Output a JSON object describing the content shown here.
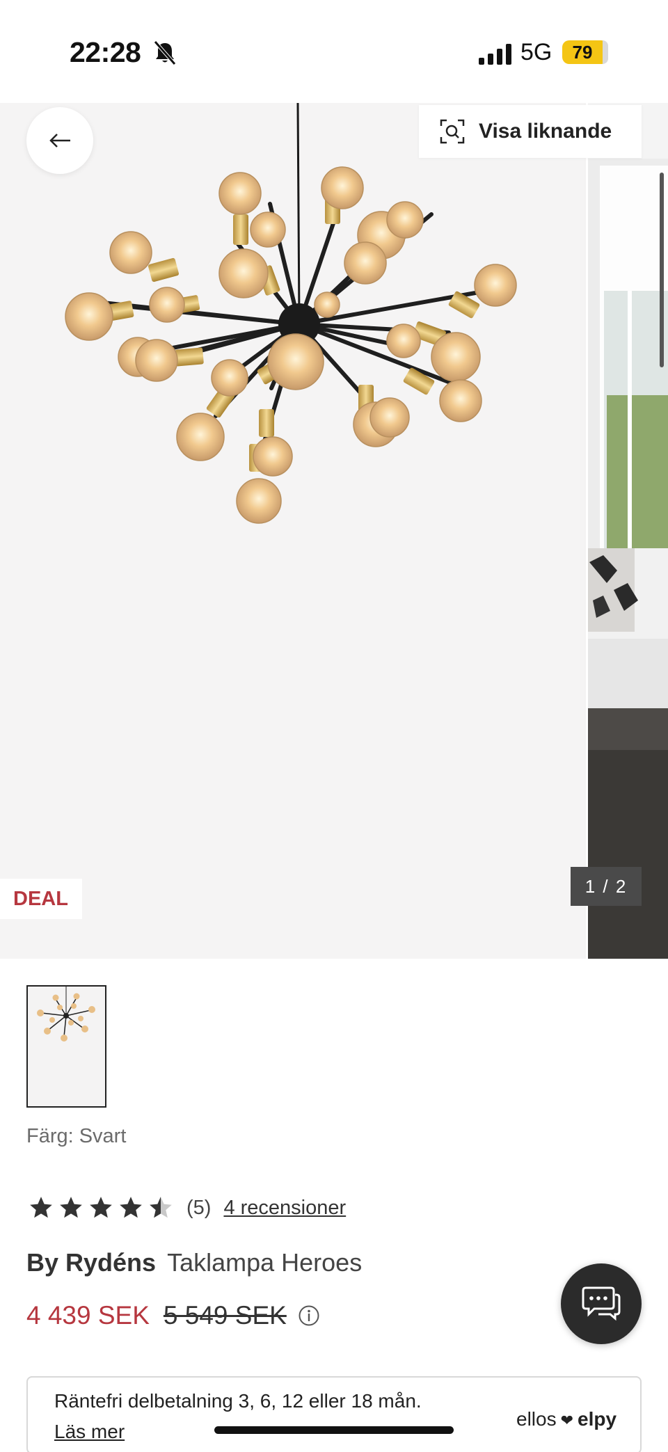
{
  "status_bar": {
    "time": "22:28",
    "network": "5G",
    "battery": "79",
    "icons": [
      "bell-slash-icon",
      "signal-icon"
    ]
  },
  "gallery": {
    "visa_liknande_label": "Visa liknande",
    "deal_badge": "DEAL",
    "counter": "1 / 2",
    "icons": [
      "arrow-left-icon",
      "visual-search-icon"
    ]
  },
  "product": {
    "color_label": "Färg:",
    "color_value": "Svart",
    "rating_value": 4.5,
    "rating_count": "(5)",
    "reviews_link": "4 recensioner",
    "brand": "By Rydéns",
    "name": "Taklampa Heroes",
    "price_new": "4 439 SEK",
    "price_old": "5 549 SEK"
  },
  "finance": {
    "text": "Räntefri delbetalning 3, 6, 12 eller 18 mån.",
    "link": "Läs mer",
    "logo_left": "ellos",
    "logo_right": "elpy"
  },
  "colors": {
    "sale_red": "#b6373f",
    "battery_yellow": "#f4c514",
    "dark": "#2b2b2b"
  }
}
